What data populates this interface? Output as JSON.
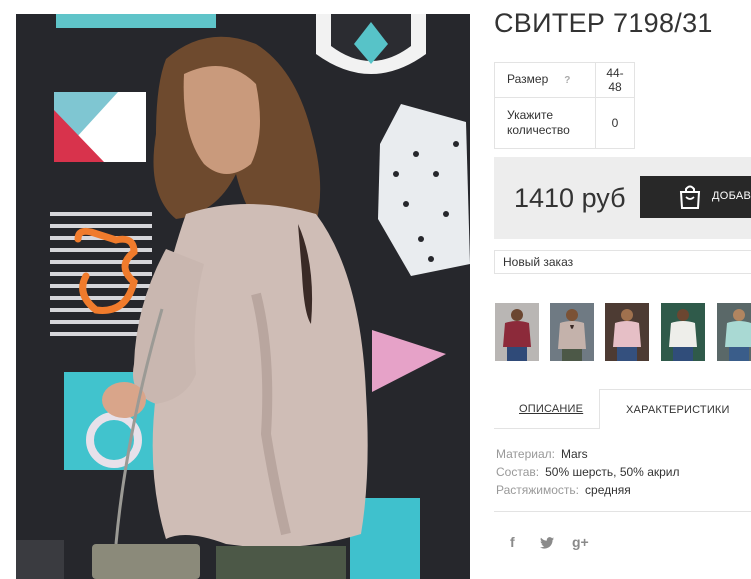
{
  "product": {
    "title": "СВИТЕР 7198/31",
    "options": {
      "size_label": "Размер",
      "size_help": "?",
      "size_value": "44-48",
      "qty_label": "Укажите количество",
      "qty_value": "0"
    },
    "price": "1410 руб",
    "add_button_label": "ДОБАВ",
    "order_select_value": "Новый заказ"
  },
  "thumbnails": [
    {
      "icon": "burgundy-sweater-photo",
      "color": "#8c2a3a"
    },
    {
      "icon": "back-view-sweater-photo",
      "color": "#c4b2ab"
    },
    {
      "icon": "pink-sweater-photo",
      "color": "#e6bfc6"
    },
    {
      "icon": "white-sweater-photo",
      "color": "#eeeeea"
    },
    {
      "icon": "mint-sweater-photo",
      "color": "#a9d9d3"
    }
  ],
  "tabs": {
    "description": "ОПИСАНИЕ",
    "characteristics": "ХАРАКТЕРИСТИКИ"
  },
  "specs": [
    {
      "key": "Материал:",
      "value": "Mars"
    },
    {
      "key": "Состав:",
      "value": "50% шерсть, 50% акрил"
    },
    {
      "key": "Растяжимость:",
      "value": "средняя"
    }
  ],
  "social": {
    "facebook": "f",
    "twitter": "twitter-icon",
    "googleplus": "g+"
  }
}
